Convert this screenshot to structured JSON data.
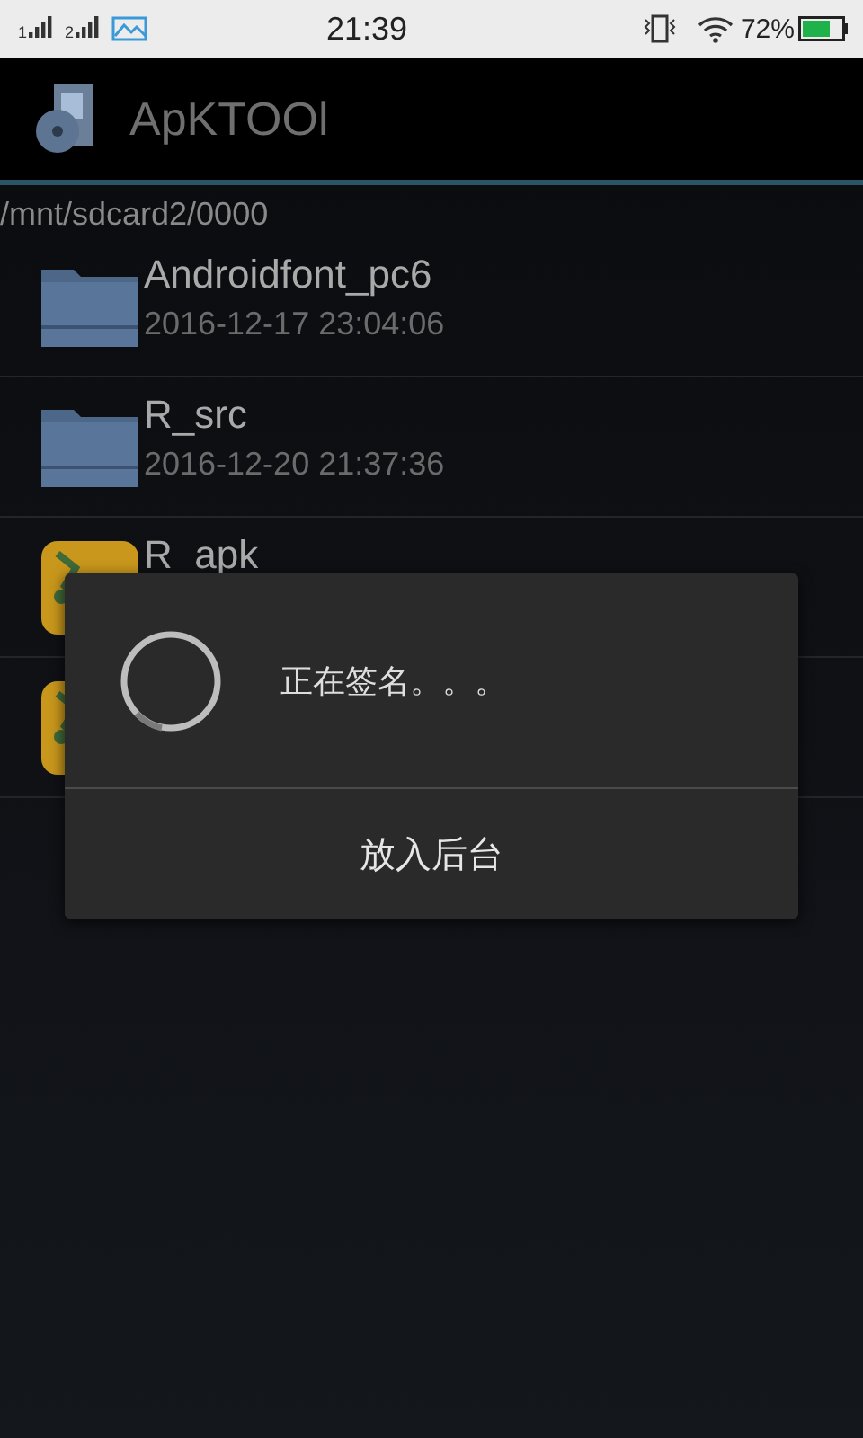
{
  "status_bar": {
    "sims": [
      "1",
      "2"
    ],
    "time": "21:39",
    "battery": "72%"
  },
  "app_bar": {
    "title": "ApKTOOl"
  },
  "path": "/mnt/sdcard2/0000",
  "files": [
    {
      "kind": "folder",
      "name": "Androidfont_pc6",
      "date": "2016-12-17 23:04:06"
    },
    {
      "kind": "folder",
      "name": "R_src",
      "date": "2016-12-20 21:37:36"
    },
    {
      "kind": "apk",
      "name": "R_apk"
    },
    {
      "kind": "apk"
    }
  ],
  "dialog": {
    "message": "正在签名。。。",
    "button": "放入后台"
  }
}
